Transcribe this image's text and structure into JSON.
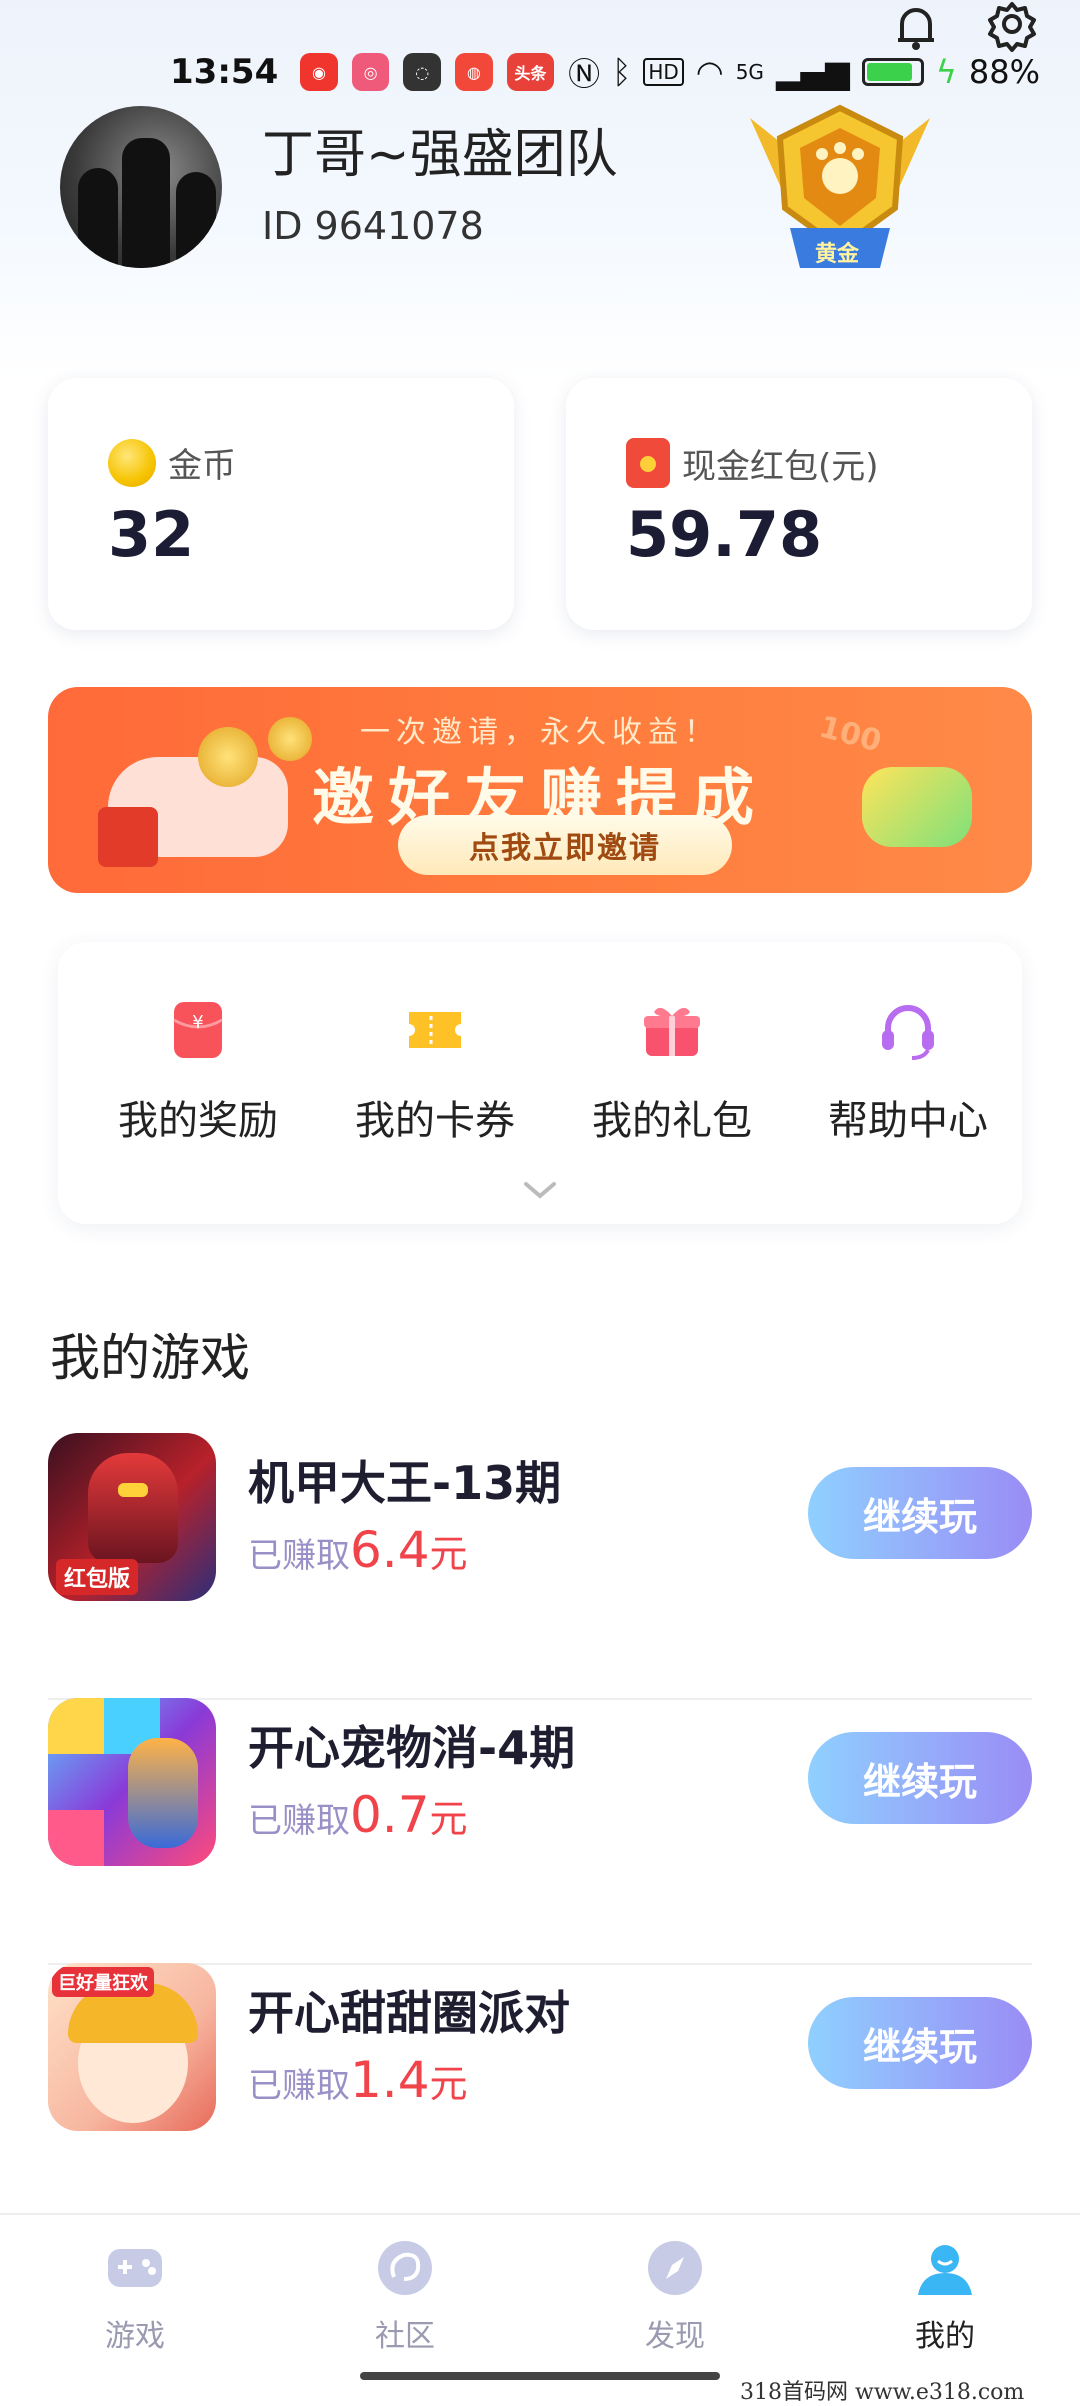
{
  "status_bar": {
    "time": "13:54",
    "network": "5G",
    "battery_percent": "88%",
    "battery_level": 0.88
  },
  "profile": {
    "username": "丁哥~强盛团队",
    "user_id": "ID 9641078",
    "level_badge": "黄金"
  },
  "wallet": {
    "coins_label": "金币",
    "coins_value": "32",
    "cash_label": "现金红包(元)",
    "cash_value": "59.78"
  },
  "banner": {
    "subtitle": "一次邀请，永久收益！",
    "title": "邀好友赚提成",
    "button": "点我立即邀请",
    "decor_text": "100"
  },
  "quick_menu": [
    {
      "label": "我的奖励",
      "icon": "red-envelope-icon"
    },
    {
      "label": "我的卡券",
      "icon": "ticket-icon"
    },
    {
      "label": "我的礼包",
      "icon": "gift-icon"
    },
    {
      "label": "帮助中心",
      "icon": "headset-icon"
    }
  ],
  "games_section": {
    "title": "我的游戏",
    "earned_prefix": "已赚取",
    "unit": "元",
    "button_label": "继续玩",
    "items": [
      {
        "name": "机甲大王-13期",
        "earned": "6.4",
        "thumb_tag": "红包版"
      },
      {
        "name": "开心宠物消-4期",
        "earned": "0.7",
        "thumb_tag": ""
      },
      {
        "name": "开心甜甜圈派对",
        "earned": "1.4",
        "thumb_tag": "巨好量狂欢"
      }
    ]
  },
  "bottom_nav": [
    {
      "label": "游戏",
      "icon": "gamepad-icon"
    },
    {
      "label": "社区",
      "icon": "community-icon"
    },
    {
      "label": "发现",
      "icon": "compass-icon"
    },
    {
      "label": "我的",
      "icon": "profile-icon",
      "active": true
    }
  ],
  "watermark": "318首码网  www.e318.com",
  "colors": {
    "accent_red": "#f0434a",
    "banner_orange": "#ff7b3c",
    "button_gradient_start": "#8fd0ff",
    "button_gradient_end": "#9a8cf5"
  }
}
